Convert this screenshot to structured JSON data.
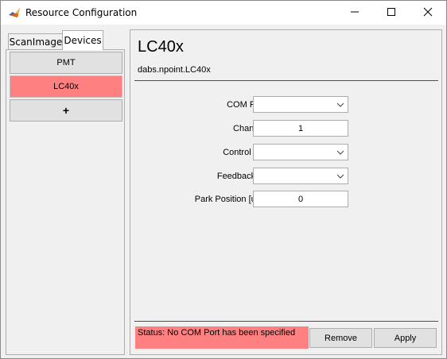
{
  "window": {
    "title": "Resource Configuration"
  },
  "tabs": [
    {
      "label": "ScanImage",
      "active": false
    },
    {
      "label": "Devices",
      "active": true
    }
  ],
  "devices": [
    {
      "label": "PMT",
      "selected": false
    },
    {
      "label": "LC40x",
      "selected": true
    },
    {
      "label": "+",
      "selected": false
    }
  ],
  "device_panel": {
    "title": "LC40x",
    "class_name": "dabs.npoint.LC40x",
    "fields": {
      "com_port": {
        "label": "COM Port",
        "value": ""
      },
      "channel": {
        "label": "Channel",
        "value": "1"
      },
      "control_ao": {
        "label": "Control AO",
        "value": ""
      },
      "feedback_ai": {
        "label": "Feedback AI",
        "value": ""
      },
      "park_position": {
        "label": "Park Position [um]",
        "value": "0"
      }
    },
    "status": "Status: No COM Port has been specified",
    "remove_label": "Remove",
    "apply_label": "Apply"
  },
  "colors": {
    "selected_highlight": "#ff8080",
    "button_face": "#e1e1e1"
  },
  "icons": [
    "matlab-icon",
    "minimize-icon",
    "maximize-icon",
    "close-icon",
    "chevron-down-icon"
  ]
}
